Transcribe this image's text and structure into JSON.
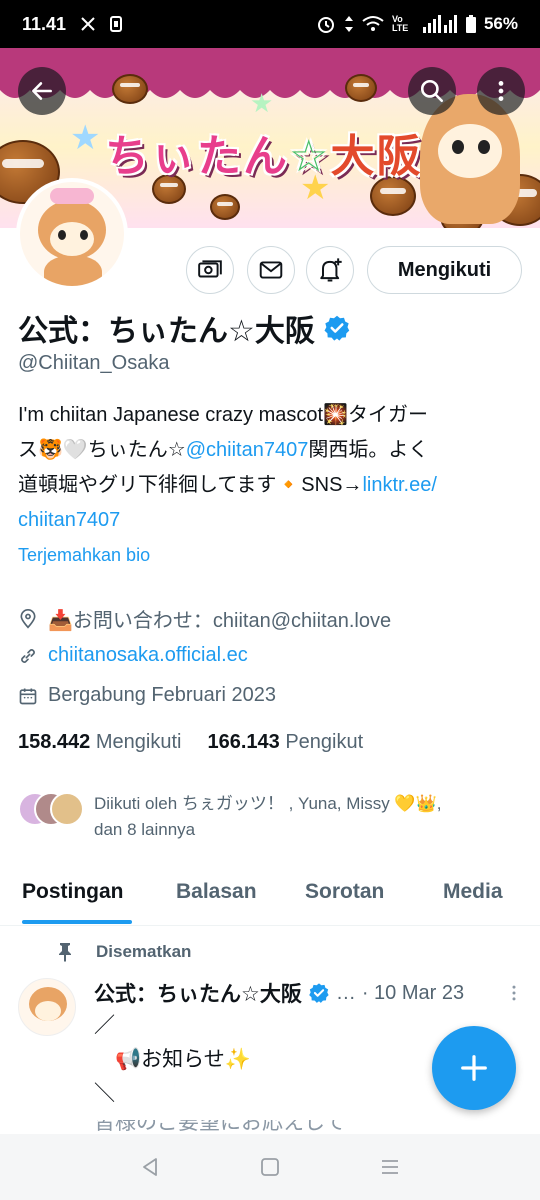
{
  "status_bar": {
    "time": "11.41",
    "battery": "56%",
    "volte_label": "Vo LTE"
  },
  "header": {
    "banner_title_part1": "ちぃたん",
    "banner_title_star": "☆",
    "banner_title_part2": "大阪",
    "back_icon": "arrow-left-icon",
    "search_icon": "search-icon",
    "more_icon": "more-vertical-icon"
  },
  "actions": {
    "follow_label": "Mengikuti",
    "icons": [
      "subscribe-icon",
      "message-icon",
      "notification-add-icon"
    ]
  },
  "profile": {
    "name": "公式：ちぃたん☆大阪",
    "handle": "@Chiitan_Osaka",
    "bio_line1": "I'm chiitan Japanese crazy mascot🎇タイガー",
    "bio_line2_a": "ス🐯🤍ちぃたん☆",
    "bio_line2_link": "@chiitan7407",
    "bio_line2_b": "関西垢。よく",
    "bio_line3_a": "道頓堀やグリ下徘徊してます🔸SNS→",
    "bio_line3_link": "linktr.ee/",
    "bio_line4_link": "chiitan7407",
    "translate_label": "Terjemahkan bio",
    "location": "📥お問い合わせ：chiitan@chiitan.love",
    "website": "chiitanosaka.official.ec",
    "joined": "Bergabung Februari 2023",
    "following_count": "158.442",
    "following_label": "Mengikuti",
    "followers_count": "166.143",
    "followers_label": "Pengikut",
    "followed_by_line1": "Diikuti oleh ちぇガッツ！ , Yuna, Missy 💛👑,",
    "followed_by_line2": "dan 8 lainnya"
  },
  "tabs": [
    {
      "label": "Postingan",
      "active": true
    },
    {
      "label": "Balasan",
      "active": false
    },
    {
      "label": "Sorotan",
      "active": false
    },
    {
      "label": "Media",
      "active": false
    }
  ],
  "post": {
    "pinned_label": "Disematkan",
    "author": "公式：ちぃたん☆大阪",
    "ellipsis": "…",
    "date": "· 10 Mar 23",
    "line1": "／",
    "line2": "　📢お知らせ✨",
    "line3": "＼",
    "line4": "皆様のご要望にお応えして"
  },
  "colors": {
    "accent": "#1d9bf0",
    "text_primary": "#0f1419",
    "text_secondary": "#536471",
    "status_bar": "#000000"
  }
}
